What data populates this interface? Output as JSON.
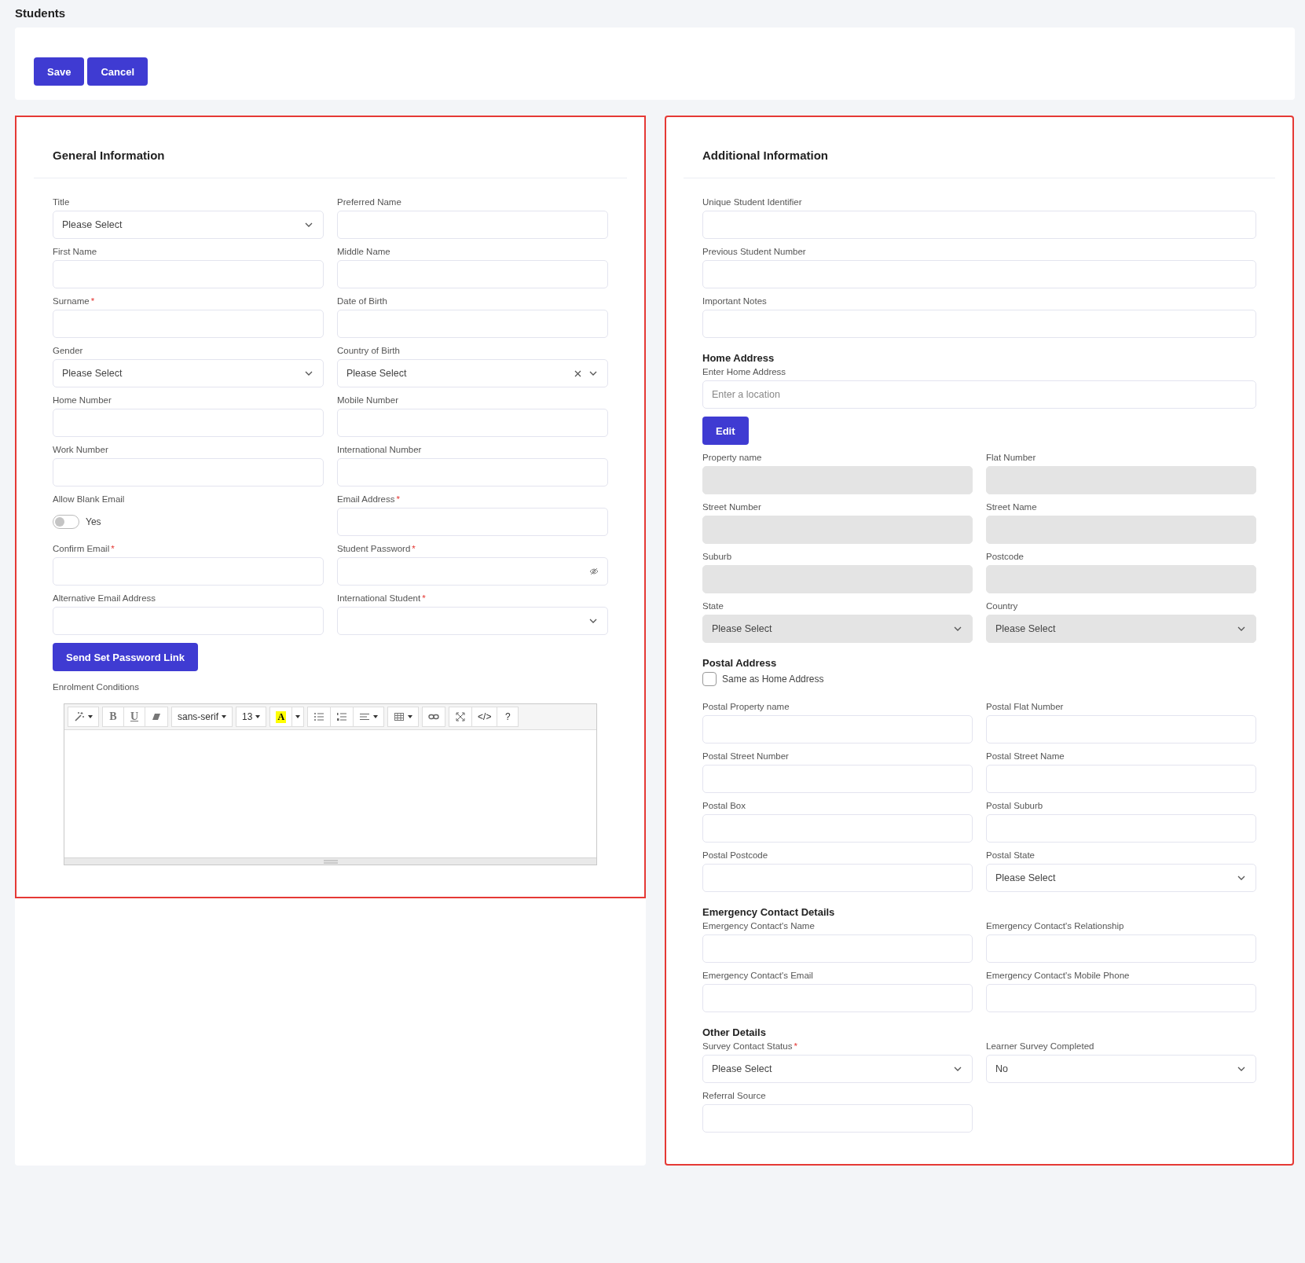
{
  "page_title": "Students",
  "actions": [
    {
      "label": "Save"
    },
    {
      "label": "Cancel"
    }
  ],
  "panels": [
    {
      "title": "General Information",
      "items": [
        {
          "kind": "select",
          "label": "Title",
          "value": "Please Select"
        },
        {
          "kind": "text",
          "label": "Preferred Name"
        },
        {
          "kind": "text",
          "label": "First Name"
        },
        {
          "kind": "text",
          "label": "Middle Name"
        },
        {
          "kind": "text",
          "label": "Surname",
          "mark": "*"
        },
        {
          "kind": "text",
          "label": "Date of Birth"
        },
        {
          "kind": "select",
          "label": "Gender",
          "value": "Please Select"
        },
        {
          "kind": "select",
          "label": "Country of Birth",
          "value": "Please Select",
          "clearable": true
        },
        {
          "kind": "text",
          "label": "Home Number"
        },
        {
          "kind": "text",
          "label": "Mobile Number"
        },
        {
          "kind": "text",
          "label": "Work Number"
        },
        {
          "kind": "text",
          "label": "International Number"
        },
        {
          "kind": "toggle",
          "label": "Allow Blank Email",
          "text": "Yes",
          "on": false
        },
        {
          "kind": "text",
          "label": "Email Address",
          "mark": "*"
        },
        {
          "kind": "text",
          "label": "Confirm Email",
          "mark": "*"
        },
        {
          "kind": "password",
          "label": "Student Password",
          "mark": "*"
        },
        {
          "kind": "text",
          "label": "Alternative Email Address"
        },
        {
          "kind": "select",
          "label": "International Student",
          "mark": "*"
        },
        {
          "kind": "button",
          "label": "Send Set Password Link"
        },
        {
          "kind": "editor",
          "label": "Enrolment Conditions",
          "toolbar": [
            [
              {
                "kind": "wand",
                "caret": true
              }
            ],
            [
              {
                "kind": "text",
                "text": "B"
              },
              {
                "kind": "text",
                "text": "U",
                "underline": true
              },
              {
                "kind": "eraser"
              }
            ],
            [
              {
                "kind": "text",
                "text": "sans-serif",
                "caret": true
              }
            ],
            [
              {
                "kind": "text",
                "text": "13",
                "caret": true
              }
            ],
            [
              {
                "kind": "highlight",
                "text": "A"
              },
              {
                "kind": "caret"
              }
            ],
            [
              {
                "kind": "bullets"
              },
              {
                "kind": "numbers"
              },
              {
                "kind": "align",
                "caret": true
              }
            ],
            [
              {
                "kind": "table",
                "caret": true
              }
            ],
            [
              {
                "kind": "link"
              }
            ],
            [
              {
                "kind": "expand"
              },
              {
                "kind": "text",
                "text": "</>"
              },
              {
                "kind": "text",
                "text": "?"
              }
            ]
          ]
        }
      ]
    },
    {
      "title": "Additional Information",
      "items": [
        {
          "kind": "text",
          "label": "Unique Student Identifier",
          "wide": true
        },
        {
          "kind": "text",
          "label": "Previous Student Number",
          "wide": true
        },
        {
          "kind": "text",
          "label": "Important Notes",
          "wide": true
        },
        {
          "kind": "heading",
          "text": "Home Address"
        },
        {
          "kind": "text",
          "label": "Enter Home Address",
          "placeholder": "Enter a location",
          "wide": true
        },
        {
          "kind": "button",
          "label": "Edit",
          "wide": true
        },
        {
          "kind": "text",
          "label": "Property name",
          "disabled": true
        },
        {
          "kind": "text",
          "label": "Flat Number",
          "disabled": true
        },
        {
          "kind": "text",
          "label": "Street Number",
          "disabled": true
        },
        {
          "kind": "text",
          "label": "Street Name",
          "disabled": true
        },
        {
          "kind": "text",
          "label": "Suburb",
          "disabled": true
        },
        {
          "kind": "text",
          "label": "Postcode",
          "disabled": true
        },
        {
          "kind": "select",
          "label": "State",
          "value": "Please Select",
          "disabled": true
        },
        {
          "kind": "select",
          "label": "Country",
          "value": "Please Select",
          "disabled": true
        },
        {
          "kind": "heading",
          "text": "Postal Address"
        },
        {
          "kind": "checkbox",
          "text": "Same as Home Address",
          "checked": false
        },
        {
          "kind": "text",
          "label": "Postal Property name"
        },
        {
          "kind": "text",
          "label": "Postal Flat Number"
        },
        {
          "kind": "text",
          "label": "Postal Street Number"
        },
        {
          "kind": "text",
          "label": "Postal Street Name"
        },
        {
          "kind": "text",
          "label": "Postal Box"
        },
        {
          "kind": "text",
          "label": "Postal Suburb"
        },
        {
          "kind": "text",
          "label": "Postal Postcode"
        },
        {
          "kind": "select",
          "label": "Postal State",
          "value": "Please Select"
        },
        {
          "kind": "heading",
          "text": "Emergency Contact Details"
        },
        {
          "kind": "text",
          "label": "Emergency Contact's Name"
        },
        {
          "kind": "text",
          "label": "Emergency Contact's Relationship"
        },
        {
          "kind": "text",
          "label": "Emergency Contact's Email"
        },
        {
          "kind": "text",
          "label": "Emergency Contact's Mobile Phone"
        },
        {
          "kind": "heading",
          "text": "Other Details"
        },
        {
          "kind": "select",
          "label": "Survey Contact Status",
          "mark": "*",
          "value": "Please Select"
        },
        {
          "kind": "select",
          "label": "Learner Survey Completed",
          "value": "No"
        },
        {
          "kind": "text",
          "label": "Referral Source"
        }
      ]
    }
  ]
}
